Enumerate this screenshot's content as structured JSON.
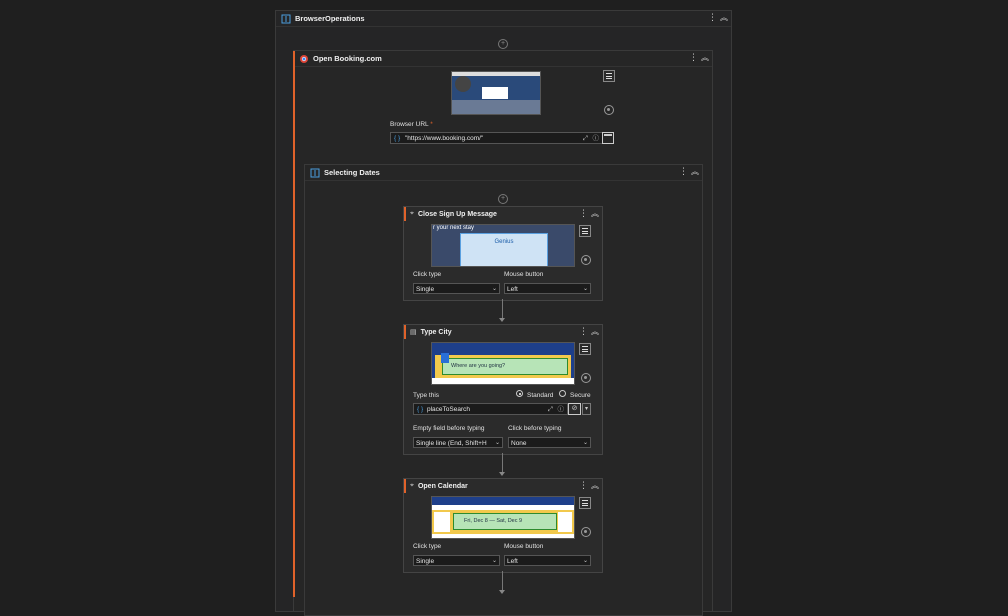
{
  "outer_sequence": {
    "title": "BrowserOperations"
  },
  "open_browser": {
    "title": "Open Booking.com",
    "url_label": "Browser URL",
    "url_required_mark": "*",
    "url_value": "\"https://www.booking.com/\""
  },
  "selecting_dates": {
    "title": "Selecting Dates"
  },
  "close_signup": {
    "title": "Close Sign Up Message",
    "click_type_label": "Click type",
    "click_type_value": "Single",
    "mouse_button_label": "Mouse button",
    "mouse_button_value": "Left",
    "thumb_text_top": "r your next stay",
    "thumb_text_btn": "Genius"
  },
  "type_city": {
    "title": "Type City",
    "type_this_label": "Type this",
    "radio_standard": "Standard",
    "radio_secure": "Secure",
    "value": "placeToSearch",
    "empty_field_label": "Empty field before typing",
    "empty_field_value": "Single line (End, Shift+H",
    "click_before_label": "Click before typing",
    "click_before_value": "None",
    "thumb_text": "Where are you going?"
  },
  "open_calendar": {
    "title": "Open Calendar",
    "click_type_label": "Click type",
    "click_type_value": "Single",
    "mouse_button_label": "Mouse button",
    "mouse_button_value": "Left",
    "thumb_text": "Fri, Dec 8  —  Sat, Dec 9"
  },
  "colors": {
    "accent": "#e0622a",
    "background": "#1f1f1f",
    "panel": "#252526"
  }
}
